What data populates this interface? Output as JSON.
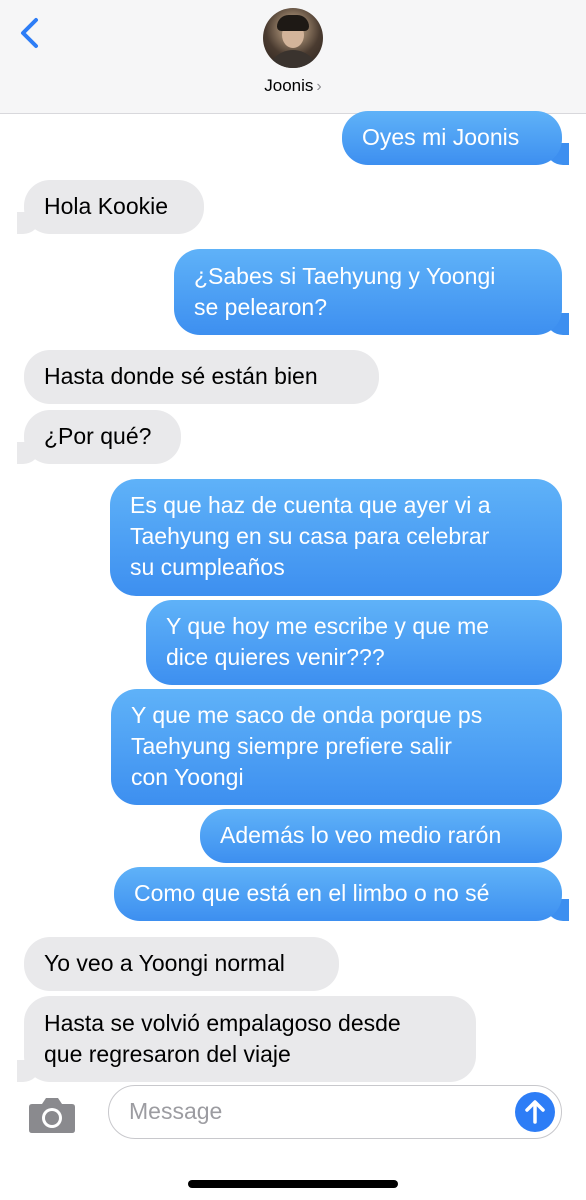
{
  "header": {
    "contact_name": "Joonis",
    "chevron": "›"
  },
  "messages": [
    {
      "from": "me",
      "text": "Oyes mi Joonis"
    },
    {
      "from": "them",
      "text": "Hola Kookie"
    },
    {
      "from": "me",
      "lines": [
        "¿Sabes si Taehyung y Yoongi",
        "se pelearon?"
      ]
    },
    {
      "from": "them",
      "text": "Hasta donde sé están bien"
    },
    {
      "from": "them",
      "text": "¿Por qué?"
    },
    {
      "from": "me",
      "lines": [
        "Es que haz de cuenta que ayer vi a",
        "Taehyung en su casa para celebrar",
        "su cumpleaños"
      ]
    },
    {
      "from": "me",
      "lines": [
        "Y que hoy me escribe y que me",
        "dice quieres venir???"
      ]
    },
    {
      "from": "me",
      "lines": [
        "Y que me saco de onda porque ps",
        "Taehyung siempre prefiere salir",
        "con Yoongi"
      ]
    },
    {
      "from": "me",
      "text": "Además lo veo medio rarón"
    },
    {
      "from": "me",
      "text": "Como que está en el limbo o no sé"
    },
    {
      "from": "them",
      "text": "Yo veo a Yoongi normal"
    },
    {
      "from": "them",
      "lines": [
        "Hasta se volvió empalagoso desde",
        "que regresaron del viaje"
      ]
    }
  ],
  "composer": {
    "placeholder": "Message",
    "value": ""
  },
  "icons": {
    "back": "chevron-left-icon",
    "camera": "camera-icon",
    "send": "arrow-up-icon"
  },
  "colors": {
    "outgoing_bubble": "#3d8ff0",
    "incoming_bubble": "#e9e9eb",
    "accent": "#2d7df6"
  }
}
